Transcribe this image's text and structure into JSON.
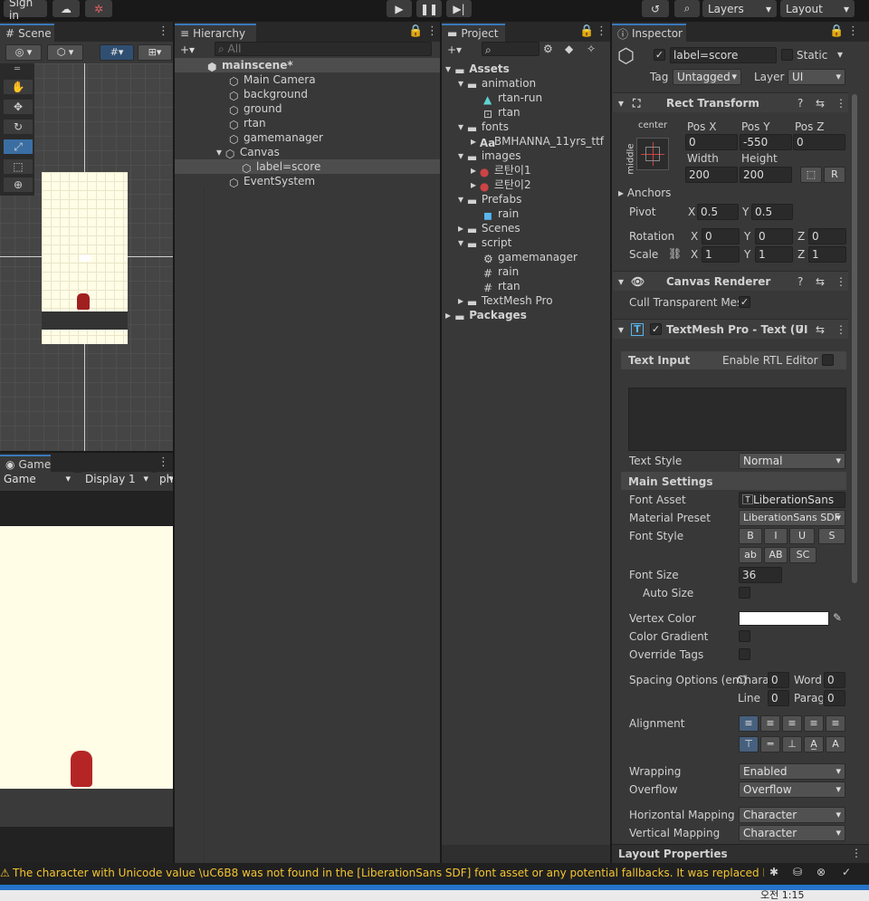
{
  "topbar": {
    "sign_in": "Sign in",
    "layers": "Layers",
    "layout": "Layout"
  },
  "scene": {
    "tab": "Scene"
  },
  "game": {
    "tab": "Game",
    "display_mode": "Game",
    "display": "Display 1",
    "resolution": "pho"
  },
  "hierarchy": {
    "tab": "Hierarchy",
    "search_placeholder": "All",
    "scene_name": "mainscene*",
    "items": [
      "Main Camera",
      "background",
      "ground",
      "rtan",
      "gamemanager",
      "Canvas",
      "label=score",
      "EventSystem"
    ]
  },
  "project": {
    "tab": "Project",
    "items": [
      "Assets",
      "animation",
      "rtan-run",
      "rtan",
      "fonts",
      "BMHANNA_11yrs_ttf",
      "images",
      "르탄이1",
      "르탄이2",
      "Prefabs",
      "rain",
      "Scenes",
      "script",
      "gamemanager",
      "rain",
      "rtan",
      "TextMesh Pro",
      "Packages"
    ]
  },
  "inspector": {
    "tab": "Inspector",
    "object_name": "label=score",
    "static_label": "Static",
    "tag_label": "Tag",
    "tag_value": "Untagged",
    "layer_label": "Layer",
    "layer_value": "UI",
    "rect": {
      "title": "Rect Transform",
      "anchor_h": "center",
      "anchor_v": "middle",
      "pos_x_label": "Pos X",
      "pos_y_label": "Pos Y",
      "pos_z_label": "Pos Z",
      "pos_x": "0",
      "pos_y": "-550",
      "pos_z": "0",
      "width_label": "Width",
      "height_label": "Height",
      "width": "200",
      "height": "200",
      "r_btn": "R",
      "anchors": "Anchors",
      "pivot": "Pivot",
      "pivot_x": "0.5",
      "pivot_y": "0.5",
      "rotation": "Rotation",
      "rot_x": "0",
      "rot_y": "0",
      "rot_z": "0",
      "scale": "Scale",
      "scale_x": "1",
      "scale_y": "1",
      "scale_z": "1"
    },
    "canvas_renderer": {
      "title": "Canvas Renderer",
      "cull_label": "Cull Transparent Mes"
    },
    "tmp": {
      "title": "TextMesh Pro - Text (UI",
      "text_input": "Text Input",
      "rtl": "Enable RTL Editor",
      "text_style_label": "Text Style",
      "text_style": "Normal",
      "main_settings": "Main Settings",
      "font_asset_label": "Font Asset",
      "font_asset": "LiberationSans",
      "material_preset_label": "Material Preset",
      "material_preset": "LiberationSans SDF",
      "font_style_label": "Font Style",
      "style_b": "B",
      "style_i": "I",
      "style_u": "U",
      "style_s": "S",
      "style_ab": "ab",
      "style_AB": "AB",
      "style_SC": "SC",
      "font_size_label": "Font Size",
      "font_size": "36",
      "auto_size": "Auto Size",
      "vertex_color": "Vertex Color",
      "color_gradient": "Color Gradient",
      "override_tags": "Override Tags",
      "spacing_label": "Spacing Options (em)",
      "chara": "Chara",
      "chara_v": "0",
      "word": "Word",
      "word_v": "0",
      "line": "Line",
      "line_v": "0",
      "parag": "Parag",
      "parag_v": "0",
      "alignment": "Alignment",
      "wrapping_label": "Wrapping",
      "wrapping": "Enabled",
      "overflow_label": "Overflow",
      "overflow": "Overflow",
      "hmap_label": "Horizontal Mapping",
      "hmap": "Character",
      "vmap_label": "Vertical Mapping",
      "vmap": "Character"
    },
    "layout_props": "Layout Properties"
  },
  "status": {
    "message": "The character with Unicode value \\uC6B8 was not found in the [LiberationSans SDF] font asset or any potential fallbacks. It was replaced by Unic",
    "clock": "오전 1:15"
  },
  "colors": {
    "accent": "#3a79bb",
    "warning": "#f4c531",
    "canvas_bg": "#fffde6"
  }
}
